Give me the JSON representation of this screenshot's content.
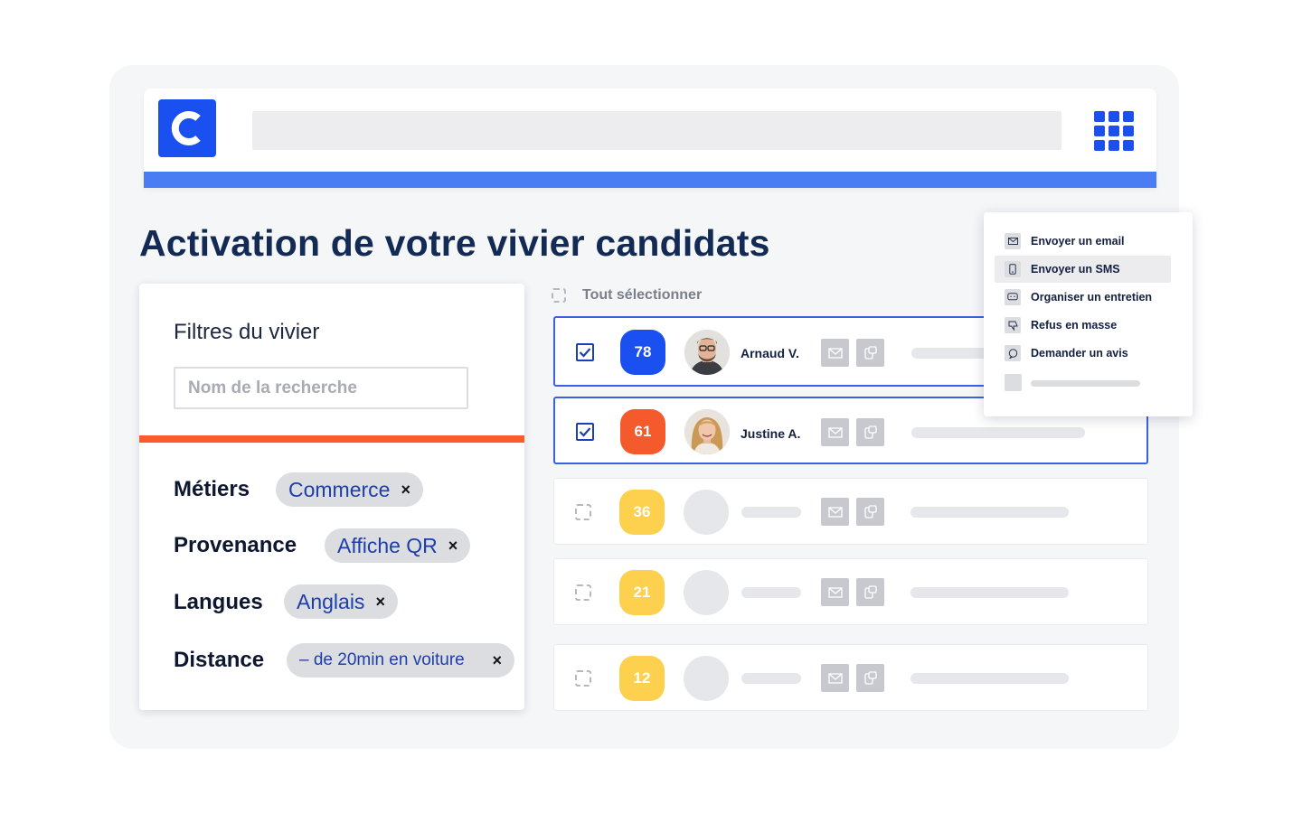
{
  "header": {
    "logo_letter": "C"
  },
  "page": {
    "title": "Activation de votre vivier candidats"
  },
  "filters": {
    "title": "Filtres du vivier",
    "search_placeholder": "Nom de la recherche",
    "rows": [
      {
        "label": "Métiers",
        "chip": "Commerce",
        "remove": "×"
      },
      {
        "label": "Provenance",
        "chip": "Affiche QR",
        "remove": "×"
      },
      {
        "label": "Langues",
        "chip": "Anglais",
        "remove": "×"
      },
      {
        "label": "Distance",
        "chip": "– de 20min en voiture",
        "remove": "×"
      }
    ]
  },
  "list": {
    "select_all_label": "Tout sélectionner",
    "candidates": [
      {
        "score": "78",
        "score_color": "#1a4ff0",
        "name": "Arnaud V.",
        "selected": true
      },
      {
        "score": "61",
        "score_color": "#f55a2c",
        "name": "Justine A.",
        "selected": true
      },
      {
        "score": "36",
        "score_color": "#fdd14e",
        "name": "",
        "selected": false
      },
      {
        "score": "21",
        "score_color": "#fdd14e",
        "name": "",
        "selected": false
      },
      {
        "score": "12",
        "score_color": "#fdd14e",
        "name": "",
        "selected": false
      }
    ]
  },
  "actions_menu": {
    "items": [
      {
        "label": "Envoyer un email",
        "icon": "mail-icon"
      },
      {
        "label": "Envoyer un SMS",
        "icon": "phone-icon",
        "active": true
      },
      {
        "label": "Organiser un entretien",
        "icon": "chat-icon"
      },
      {
        "label": "Refus en masse",
        "icon": "thumbs-down-icon"
      },
      {
        "label": "Demander un avis",
        "icon": "speech-icon"
      }
    ]
  },
  "colors": {
    "brand_blue": "#1a4ff0",
    "stripe_blue": "#4a7cf3",
    "orange": "#fb5a2c",
    "yellow": "#fdd14e",
    "navy": "#132a55"
  }
}
